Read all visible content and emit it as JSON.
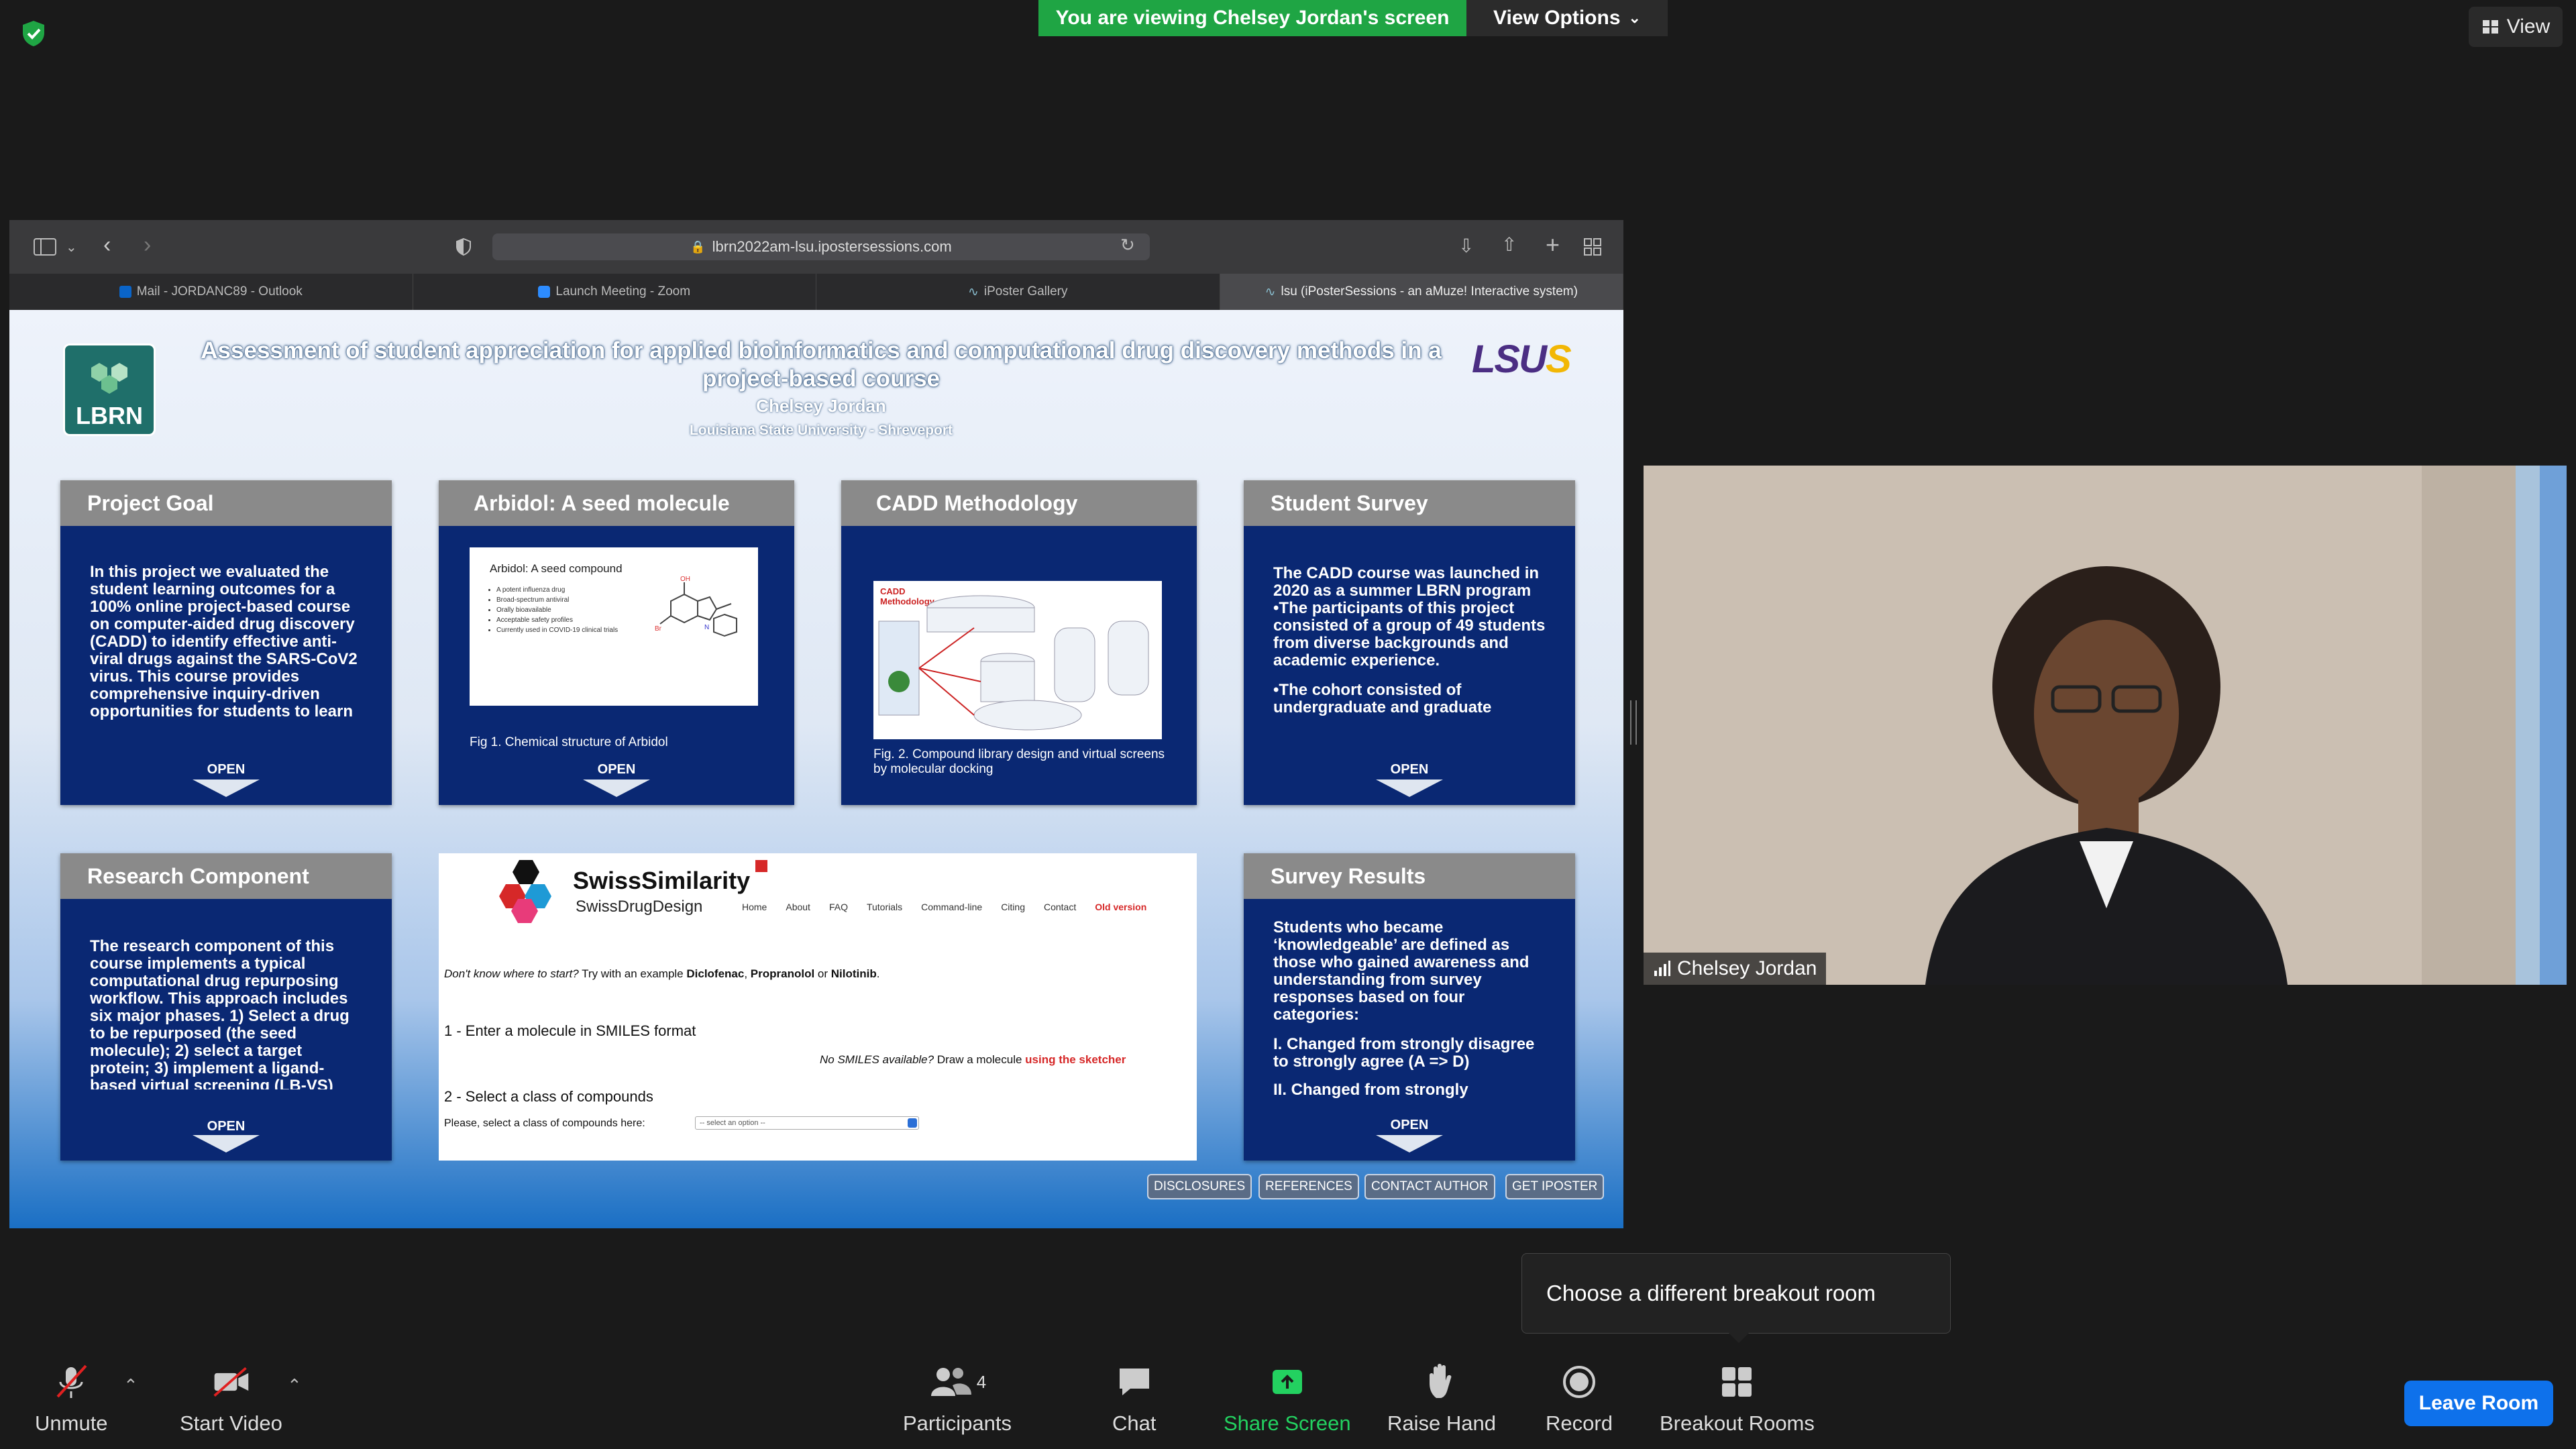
{
  "top_bar": {
    "viewing_banner": "You are viewing Chelsey Jordan's screen",
    "view_options": "View Options",
    "view_button": "View"
  },
  "browser": {
    "url": "lbrn2022am-lsu.ipostersessions.com",
    "tabs": [
      {
        "label": "Mail - JORDANC89 - Outlook"
      },
      {
        "label": "Launch Meeting - Zoom"
      },
      {
        "label": "iPoster Gallery"
      },
      {
        "label": "lsu (iPosterSessions - an aMuze! Interactive system)"
      }
    ]
  },
  "poster": {
    "logo_text": "LBRN",
    "lsu_logo": "LSUS",
    "title": "Assessment of student appreciation for applied bioinformatics and computational drug discovery methods in a project-based course",
    "author": "Chelsey Jordan",
    "affiliation": "Louisiana State University - Shreveport",
    "open_label": "OPEN",
    "panels": {
      "project_goal": {
        "heading": "Project Goal",
        "body": "In this project we evaluated the student learning outcomes for a 100% online project-based course on computer-aided drug discovery (CADD) to identify effective anti-viral drugs against the SARS-CoV2 virus. This course provides comprehensive inquiry-driven opportunities for students to learn and apply various databases and computer"
      },
      "arbidol": {
        "heading": "Arbidol: A seed molecule",
        "fig_title": "Arbidol: A seed compound",
        "fig_bullets": [
          "A potent influenza drug",
          "Broad-spectrum antiviral",
          "Orally bioavailable",
          "Acceptable safety profiles",
          "Currently used in COVID-19 clinical trials"
        ],
        "caption": "Fig 1. Chemical structure of Arbidol"
      },
      "cadd": {
        "heading": "CADD Methodology",
        "fig_label": "CADD Methodology",
        "caption": "Fig. 2.  Compound library design and virtual screens by molecular docking"
      },
      "student_survey": {
        "heading": "Student Survey",
        "body_lines": [
          "The CADD course was launched in 2020 as a summer LBRN program",
          "•The participants of this project consisted of a group of 49 students from diverse backgrounds and academic experience.",
          "•The cohort consisted of undergraduate and graduate"
        ]
      },
      "research_component": {
        "heading": "Research Component",
        "body": "The research component of this course implements a typical computational drug repurposing workflow. This approach includes six major phases. 1) Select a drug to be repurposed (the seed molecule); 2) select a target protein; 3) implement a ligand-based virtual screening (LB-VS) approach to assemble a"
      },
      "survey_results": {
        "heading": "Survey Results",
        "body_lines": [
          "Students who became ‘knowledgeable’ are defined as those who gained awareness and understanding from survey responses based on four categories:",
          "I. Changed from strongly disagree to strongly agree (A => D)",
          "II. Changed from strongly"
        ]
      }
    },
    "swiss": {
      "title": "SwissSimilarity",
      "subtitle": "SwissDrugDesign",
      "nav": [
        "Home",
        "About",
        "FAQ",
        "Tutorials",
        "Command-line",
        "Citing",
        "Contact",
        "Old version"
      ],
      "example_prefix": "Don't know where to start?",
      "example_mid": " Try with an example ",
      "ex1": "Diclofenac",
      "sep1": ", ",
      "ex2": "Propranolol",
      "sep2": " or ",
      "ex3": "Nilotinib",
      "dot": ".",
      "step1": "1 - Enter a molecule in SMILES format",
      "no_smiles": "No SMILES available?",
      "draw": " Draw a molecule ",
      "sketcher": "using the sketcher",
      "step2": "2 - Select a class of compounds",
      "select_label": "Please, select a class of compounds here:",
      "select_placeholder": "-- select an option --"
    },
    "buttons": [
      "DISCLOSURES",
      "REFERENCES",
      "CONTACT AUTHOR",
      "GET IPOSTER"
    ]
  },
  "video": {
    "participant_name": "Chelsey Jordan"
  },
  "tooltip": "Choose a different breakout room",
  "toolbar": {
    "unmute": "Unmute",
    "start_video": "Start Video",
    "participants": "Participants",
    "participants_count": "4",
    "chat": "Chat",
    "share_screen": "Share Screen",
    "raise_hand": "Raise Hand",
    "record": "Record",
    "breakout_rooms": "Breakout Rooms",
    "leave_room": "Leave Room"
  },
  "colors": {
    "zoom_green": "#1fa544",
    "zoom_blue": "#0e71eb",
    "poster_navy": "#0a2873"
  }
}
